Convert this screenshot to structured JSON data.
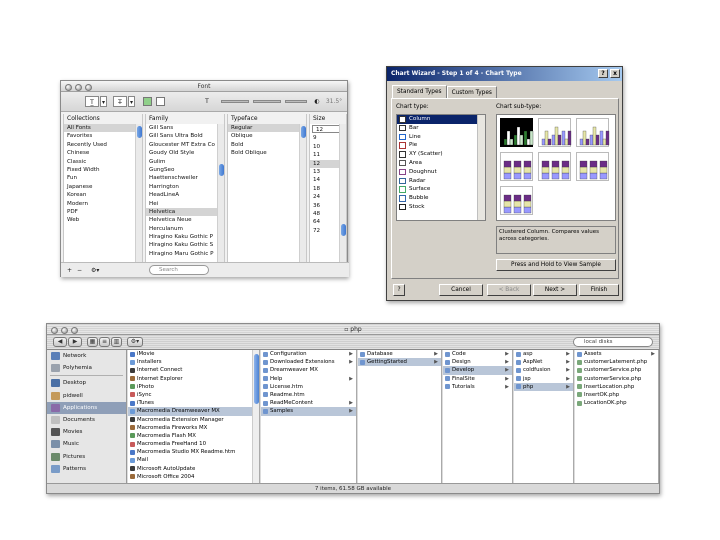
{
  "font_panel": {
    "title": "Font",
    "toolbar": {
      "size_readout": "31.5°"
    },
    "columns": [
      {
        "header": "Collections",
        "items": [
          "All Fonts",
          "Favorites",
          "Recently Used",
          "Chinese",
          "Classic",
          "Fixed Width",
          "Fun",
          "Japanese",
          "Korean",
          "Modern",
          "PDF",
          "Web"
        ],
        "selected": 0
      },
      {
        "header": "Family",
        "items": [
          "Gill Sans",
          "Gill Sans Ultra Bold",
          "Gloucester MT Extra Co",
          "Goudy Old Style",
          "Gulim",
          "GungSeo",
          "Haettenschweiler",
          "Harrington",
          "HeadLineA",
          "Hei",
          "Helvetica",
          "Helvetica Neue",
          "Herculanum",
          "Hiragino Kaku Gothic P",
          "Hiragino Kaku Gothic S",
          "Hiragino Maru Gothic P"
        ],
        "selected": 10
      },
      {
        "header": "Typeface",
        "items": [
          "Regular",
          "Oblique",
          "Bold",
          "Bold Oblique"
        ],
        "selected": 0
      },
      {
        "header": "Size",
        "items": [
          "9",
          "10",
          "11",
          "12",
          "13",
          "14",
          "18",
          "24",
          "36",
          "48",
          "64",
          "72"
        ],
        "selected": 3,
        "value": "12"
      }
    ],
    "bottom": {
      "search_placeholder": "Search"
    }
  },
  "chart_wizard": {
    "title": "Chart Wizard - Step 1 of 4 - Chart Type",
    "title_buttons": [
      "?",
      "x"
    ],
    "tabs": [
      "Standard Types",
      "Custom Types"
    ],
    "chart_type_label": "Chart type:",
    "chart_subtype_label": "Chart sub-type:",
    "chart_types": [
      {
        "label": "Column",
        "icon": "column-chart-icon"
      },
      {
        "label": "Bar",
        "icon": "bar-chart-icon"
      },
      {
        "label": "Line",
        "icon": "line-chart-icon"
      },
      {
        "label": "Pie",
        "icon": "pie-chart-icon"
      },
      {
        "label": "XY (Scatter)",
        "icon": "scatter-chart-icon"
      },
      {
        "label": "Area",
        "icon": "area-chart-icon"
      },
      {
        "label": "Doughnut",
        "icon": "doughnut-chart-icon"
      },
      {
        "label": "Radar",
        "icon": "radar-chart-icon"
      },
      {
        "label": "Surface",
        "icon": "surface-chart-icon"
      },
      {
        "label": "Bubble",
        "icon": "bubble-chart-icon"
      },
      {
        "label": "Stock",
        "icon": "stock-chart-icon"
      }
    ],
    "selected_type": 0,
    "description": "Clustered Column. Compares values across categories.",
    "press_hold_label": "Press and Hold to View Sample",
    "buttons": {
      "help": "?",
      "cancel": "Cancel",
      "back": "< Back",
      "next": "Next >",
      "finish": "Finish"
    },
    "colors": {
      "accent": "#0a246a",
      "bar_a": "#6b2d86",
      "bar_b": "#e6e6a8",
      "bar_c": "#9999ff",
      "bar_d": "#993366"
    }
  },
  "finder": {
    "title": "php",
    "search_placeholder": "local disks",
    "toolbar_buttons": [
      "back",
      "forward",
      "icon-view",
      "list-view",
      "column-view",
      "action"
    ],
    "sidebar": [
      {
        "label": "Network",
        "icon": "network-icon",
        "color": "#5a7fb8"
      },
      {
        "label": "Polyhemia",
        "icon": "drive-icon",
        "color": "#9aa2ad"
      },
      {
        "sep": true
      },
      {
        "label": "Desktop",
        "icon": "desktop-icon",
        "color": "#4a6fa5"
      },
      {
        "label": "pidwell",
        "icon": "home-icon",
        "color": "#c49a5a"
      },
      {
        "label": "Applications",
        "icon": "applications-icon",
        "color": "#8a6aa8",
        "selected": true
      },
      {
        "label": "Documents",
        "icon": "documents-icon",
        "color": "#c0c0c0"
      },
      {
        "label": "Movies",
        "icon": "movies-icon",
        "color": "#555555"
      },
      {
        "label": "Music",
        "icon": "music-icon",
        "color": "#7a8fa8"
      },
      {
        "label": "Pictures",
        "icon": "pictures-icon",
        "color": "#6a8a6a"
      },
      {
        "label": "Patterns",
        "icon": "folder-icon",
        "color": "#7a9cc8"
      }
    ],
    "columns": [
      {
        "items": [
          "iMovie",
          "Installers",
          "Internet Connect",
          "Internet Explorer",
          "iPhoto",
          "iSync",
          "iTunes",
          "Macromedia Dreamweaver MX",
          "Macromedia Extension Manager",
          "Macromedia Fireworks MX",
          "Macromedia Flash MX",
          "Macromedia FreeHand 10",
          "Macromedia Studio MX Readme.htm",
          "Mail",
          "Microsoft AutoUpdate",
          "Microsoft Office 2004"
        ],
        "selected": 7,
        "arrows": [
          1,
          7,
          8,
          9,
          10,
          11,
          15
        ]
      },
      {
        "items": [
          "Configuration",
          "Downloaded Extensions",
          "Dreamweaver MX",
          "Help",
          "License.htm",
          "Readme.htm",
          "ReadMeContent",
          "Samples"
        ],
        "selected": 7,
        "arrows": [
          0,
          1,
          3,
          6,
          7
        ]
      },
      {
        "items": [
          "Database",
          "GettingStarted"
        ],
        "selected": 1,
        "arrows": [
          0,
          1
        ]
      },
      {
        "items": [
          "Code",
          "Design",
          "Develop",
          "FinalSite",
          "Tutorials"
        ],
        "selected": 2,
        "arrows": [
          0,
          1,
          2,
          3,
          4
        ]
      },
      {
        "items": [
          "asp",
          "AspNet",
          "coldfusion",
          "jsp",
          "php"
        ],
        "selected": 4,
        "arrows": [
          0,
          1,
          2,
          3,
          4
        ]
      },
      {
        "items": [
          "Assets",
          "customerLatement.php",
          "customerService.php",
          "customerService.php",
          "InsertLocation.php",
          "InsertOK.php",
          "LocationOK.php"
        ],
        "selected": -1,
        "arrows": [
          0
        ]
      }
    ],
    "status": "7 items, 61.58 GB available"
  }
}
